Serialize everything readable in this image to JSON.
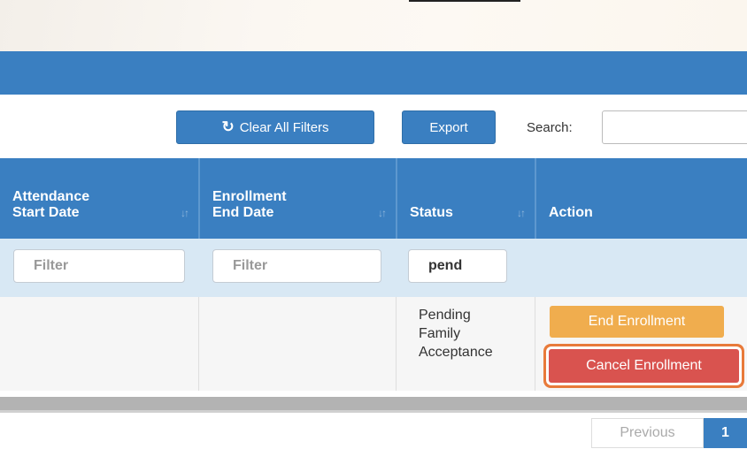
{
  "toolbar": {
    "clear_filters_label": "Clear All Filters",
    "export_label": "Export",
    "search_label": "Search:",
    "search_value": ""
  },
  "table": {
    "columns": [
      {
        "line1": "Attendance",
        "line2": "Start Date",
        "sortable": true
      },
      {
        "line1": "Enrollment",
        "line2": "End Date",
        "sortable": true
      },
      {
        "line1": "",
        "line2": "Status",
        "sortable": true
      },
      {
        "line1": "",
        "line2": "Action",
        "sortable": false
      }
    ],
    "filters": [
      {
        "placeholder": "Filter",
        "value": ""
      },
      {
        "placeholder": "Filter",
        "value": ""
      },
      {
        "placeholder": "",
        "value": "pend"
      }
    ],
    "rows": [
      {
        "attendance_start_date": "",
        "enrollment_end_date": "",
        "status": [
          "Pending",
          "Family",
          "Acceptance"
        ],
        "actions": {
          "end_label": "End Enrollment",
          "cancel_label": "Cancel Enrollment"
        }
      }
    ]
  },
  "pagination": {
    "previous_label": "Previous",
    "current_page": "1"
  },
  "colors": {
    "primary": "#3a7fc1",
    "filter_row": "#d8e8f4",
    "warning": "#f0ad4e",
    "danger": "#d9534f",
    "highlight_outline": "#e87a3a"
  },
  "icons": {
    "clear_filters": "refresh-icon",
    "sort": "sort-icon"
  }
}
